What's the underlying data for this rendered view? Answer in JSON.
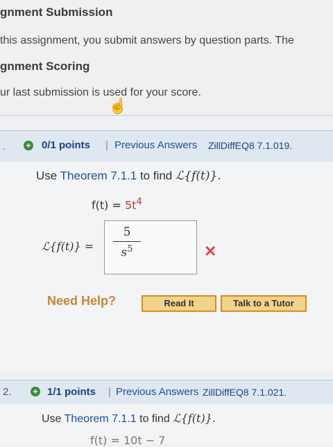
{
  "section1": {
    "title": "gnment Submission",
    "text": "this assignment, you submit answers by question parts. The"
  },
  "section2": {
    "title": "gnment Scoring",
    "text": "ur last submission is used for your score."
  },
  "q1": {
    "number": ".",
    "points": "0/1 points",
    "sep": "|",
    "prev_answers": "Previous Answers",
    "code": "ZillDiffEQ8 7.1.019.",
    "prompt_pre": "Use",
    "theorem": "Theorem 7.1.1",
    "prompt_mid": "to find",
    "prompt_math": "ℒ{f(t)}.",
    "func_lhs": "f(t) = ",
    "func_rhs": "5t",
    "func_exp": "4",
    "lapl_label": "ℒ{f(t)} =",
    "answer_num": "5",
    "answer_den": "s",
    "answer_den_exp": "5",
    "result": "✕",
    "need_help": "Need Help?",
    "read_it": "Read It",
    "talk_tutor": "Talk to a Tutor"
  },
  "q2": {
    "number": "2.",
    "points": "1/1 points",
    "sep": "|",
    "prev_answers": "Previous Answers",
    "code": "ZillDiffEQ8 7.1.021.",
    "prompt_pre": "Use",
    "theorem": "Theorem 7.1.1",
    "prompt_mid": "to find",
    "prompt_math": "ℒ{f(t)}.",
    "func": "f(t) = 10t − 7"
  }
}
